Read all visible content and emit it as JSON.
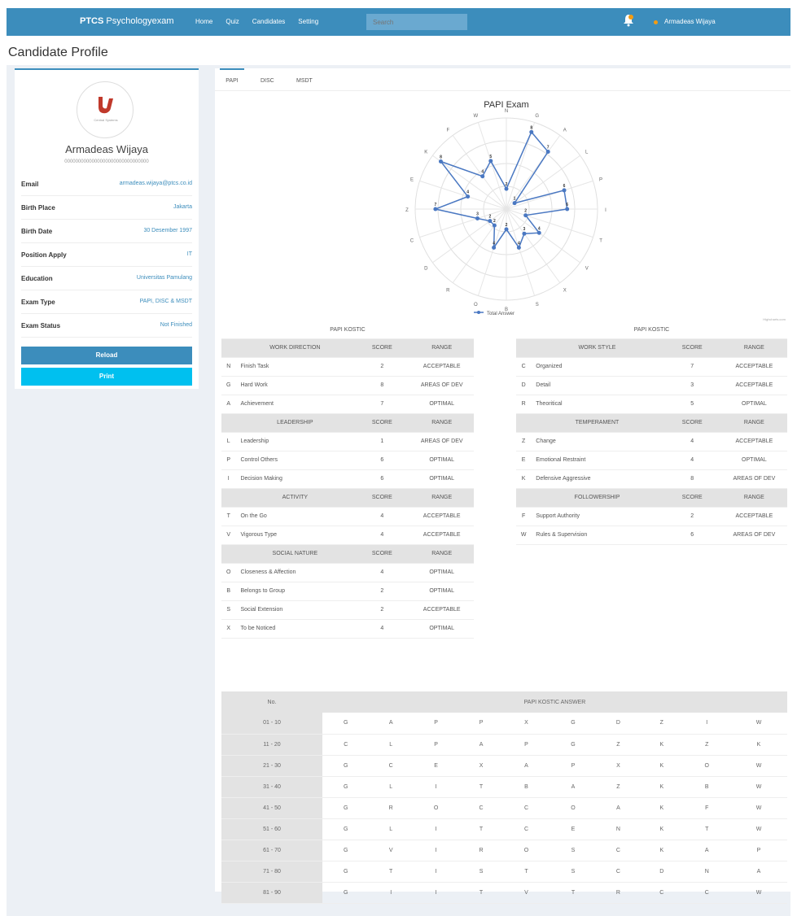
{
  "navbar": {
    "brand_bold": "PTCS",
    "brand_rest": "Psychologyexam",
    "links": [
      "Home",
      "Quiz",
      "Candidates",
      "Setting"
    ],
    "search_placeholder": "Search",
    "user_name": "Armadeas Wijaya",
    "bg_color": "#3c8dbc"
  },
  "page_title": "Candidate Profile",
  "profile": {
    "logo_text": "Central Systems",
    "name": "Armadeas Wijaya",
    "subtitle": "0000000000000000000000000000000",
    "fields": [
      {
        "label": "Email",
        "value": "armadeas.wijaya@ptcs.co.id"
      },
      {
        "label": "Birth Place",
        "value": "Jakarta"
      },
      {
        "label": "Birth Date",
        "value": "30 Desember 1997"
      },
      {
        "label": "Position Apply",
        "value": "IT"
      },
      {
        "label": "Education",
        "value": "Universitas Pamulang"
      },
      {
        "label": "Exam Type",
        "value": "PAPI, DISC & MSDT"
      },
      {
        "label": "Exam Status",
        "value": "Not Finished"
      }
    ],
    "reload_label": "Reload",
    "print_label": "Print"
  },
  "tabs": [
    "PAPI",
    "DISC",
    "MSDT"
  ],
  "chart_data": {
    "type": "radar",
    "title": "PAPI Exam",
    "legend": "Total Answer",
    "credit": "Highcharts.com",
    "categories": [
      "N",
      "G",
      "A",
      "L",
      "P",
      "I",
      "T",
      "V",
      "X",
      "S",
      "B",
      "O",
      "R",
      "D",
      "C",
      "Z",
      "E",
      "K",
      "F",
      "W"
    ],
    "values": [
      2,
      8,
      7,
      1,
      6,
      6,
      2,
      4,
      3,
      4,
      2,
      4,
      2,
      2,
      3,
      7,
      4,
      8,
      4,
      5
    ],
    "max": 9
  },
  "left_table": {
    "caption": "PAPI KOSTIC",
    "sections": [
      {
        "title": "WORK DIRECTION",
        "score_header": "SCORE",
        "range_header": "RANGE",
        "rows": [
          {
            "code": "N",
            "name": "Finish Task",
            "score": "2",
            "range": "ACCEPTABLE"
          },
          {
            "code": "G",
            "name": "Hard Work",
            "score": "8",
            "range": "AREAS OF DEV"
          },
          {
            "code": "A",
            "name": "Achievement",
            "score": "7",
            "range": "OPTIMAL"
          }
        ]
      },
      {
        "title": "LEADERSHIP",
        "score_header": "SCORE",
        "range_header": "RANGE",
        "rows": [
          {
            "code": "L",
            "name": "Leadership",
            "score": "1",
            "range": "AREAS OF DEV"
          },
          {
            "code": "P",
            "name": "Control Others",
            "score": "6",
            "range": "OPTIMAL"
          },
          {
            "code": "I",
            "name": "Decision Making",
            "score": "6",
            "range": "OPTIMAL"
          }
        ]
      },
      {
        "title": "ACTIVITY",
        "score_header": "SCORE",
        "range_header": "RANGE",
        "rows": [
          {
            "code": "T",
            "name": "On the Go",
            "score": "4",
            "range": "ACCEPTABLE"
          },
          {
            "code": "V",
            "name": "Vigorous Type",
            "score": "4",
            "range": "ACCEPTABLE"
          }
        ]
      },
      {
        "title": "SOCIAL NATURE",
        "score_header": "SCORE",
        "range_header": "RANGE",
        "rows": [
          {
            "code": "O",
            "name": "Closeness & Affection",
            "score": "4",
            "range": "OPTIMAL"
          },
          {
            "code": "B",
            "name": "Belongs to Group",
            "score": "2",
            "range": "OPTIMAL"
          },
          {
            "code": "S",
            "name": "Social Extension",
            "score": "2",
            "range": "ACCEPTABLE"
          },
          {
            "code": "X",
            "name": "To be Noticed",
            "score": "4",
            "range": "OPTIMAL"
          }
        ]
      }
    ]
  },
  "right_table": {
    "caption": "PAPI KOSTIC",
    "sections": [
      {
        "title": "WORK STYLE",
        "score_header": "SCORE",
        "range_header": "RANGE",
        "rows": [
          {
            "code": "C",
            "name": "Organized",
            "score": "7",
            "range": "ACCEPTABLE"
          },
          {
            "code": "D",
            "name": "Detail",
            "score": "3",
            "range": "ACCEPTABLE"
          },
          {
            "code": "R",
            "name": "Theoritical",
            "score": "5",
            "range": "OPTIMAL"
          }
        ]
      },
      {
        "title": "TEMPERAMENT",
        "score_header": "SCORE",
        "range_header": "RANGE",
        "rows": [
          {
            "code": "Z",
            "name": "Change",
            "score": "4",
            "range": "ACCEPTABLE"
          },
          {
            "code": "E",
            "name": "Emotional Restraint",
            "score": "4",
            "range": "OPTIMAL"
          },
          {
            "code": "K",
            "name": "Defensive Aggressive",
            "score": "8",
            "range": "AREAS OF DEV"
          }
        ]
      },
      {
        "title": "FOLLOWERSHIP",
        "score_header": "SCORE",
        "range_header": "RANGE",
        "rows": [
          {
            "code": "F",
            "name": "Support Authority",
            "score": "2",
            "range": "ACCEPTABLE"
          },
          {
            "code": "W",
            "name": "Rules & Supervision",
            "score": "6",
            "range": "AREAS OF DEV"
          }
        ]
      }
    ]
  },
  "answers": {
    "no_header": "No.",
    "answer_header": "PAPI KOSTIC ANSWER",
    "rows": [
      {
        "no": "01 - 10",
        "cells": [
          "G",
          "A",
          "P",
          "P",
          "X",
          "G",
          "D",
          "Z",
          "I",
          "W"
        ]
      },
      {
        "no": "11 - 20",
        "cells": [
          "C",
          "L",
          "P",
          "A",
          "P",
          "G",
          "Z",
          "K",
          "Z",
          "K"
        ]
      },
      {
        "no": "21 - 30",
        "cells": [
          "G",
          "C",
          "E",
          "X",
          "A",
          "P",
          "X",
          "K",
          "O",
          "W"
        ]
      },
      {
        "no": "31 - 40",
        "cells": [
          "G",
          "L",
          "I",
          "T",
          "B",
          "A",
          "Z",
          "K",
          "B",
          "W"
        ]
      },
      {
        "no": "41 - 50",
        "cells": [
          "G",
          "R",
          "O",
          "C",
          "C",
          "O",
          "A",
          "K",
          "F",
          "W"
        ]
      },
      {
        "no": "51 - 60",
        "cells": [
          "G",
          "L",
          "I",
          "T",
          "C",
          "E",
          "N",
          "K",
          "T",
          "W"
        ]
      },
      {
        "no": "61 - 70",
        "cells": [
          "G",
          "V",
          "I",
          "R",
          "O",
          "S",
          "C",
          "K",
          "A",
          "P"
        ]
      },
      {
        "no": "71 - 80",
        "cells": [
          "G",
          "T",
          "I",
          "S",
          "T",
          "S",
          "C",
          "D",
          "N",
          "A"
        ]
      },
      {
        "no": "81 - 90",
        "cells": [
          "G",
          "I",
          "I",
          "T",
          "V",
          "T",
          "R",
          "C",
          "C",
          "W"
        ]
      }
    ]
  }
}
